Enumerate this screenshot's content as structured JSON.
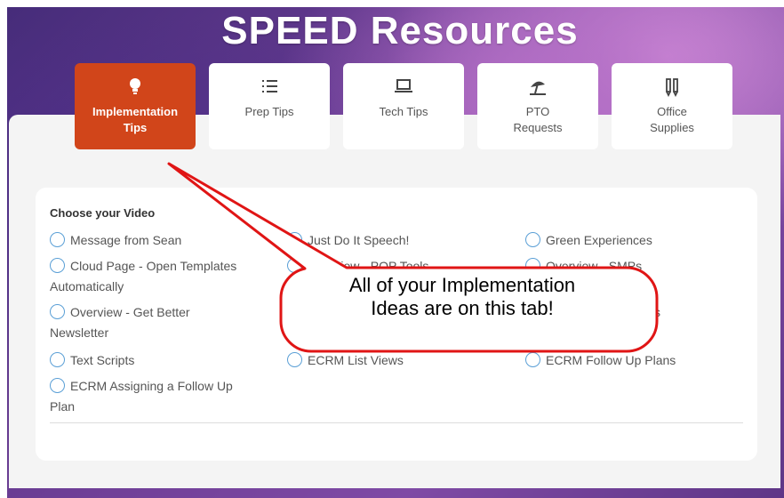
{
  "title": "SPEED Resources",
  "tabs": [
    {
      "label1": "Implementation",
      "label2": "Tips",
      "icon": "lightbulb-icon",
      "active": true
    },
    {
      "label1": "Prep Tips",
      "label2": "",
      "icon": "list-icon",
      "active": false
    },
    {
      "label1": "Tech Tips",
      "label2": "",
      "icon": "laptop-icon",
      "active": false
    },
    {
      "label1": "PTO",
      "label2": "Requests",
      "icon": "beach-umbrella-icon",
      "active": false
    },
    {
      "label1": "Office",
      "label2": "Supplies",
      "icon": "pencils-icon",
      "active": false
    }
  ],
  "video_group": {
    "legend": "Choose your Video",
    "options": {
      "message_from_sean": "Message from Sean",
      "cloud_page_1": "Cloud Page - Open Templates",
      "cloud_page_2": "Automatically",
      "overview_newsletter_1": "Overview - Get Better",
      "overview_newsletter_2": "Newsletter",
      "text_scripts": "Text Scripts",
      "ecrm_assigning_1": "ECRM Assigning a Follow Up",
      "ecrm_assigning_2": "Plan",
      "just_do_it": "Just Do It Speech!",
      "ecrm_list_views": "ECRM List Views",
      "green_experiences": "Green Experiences",
      "ecrm_follow_up_plans": "ECRM Follow Up Plans",
      "partial_col2_row2": "Overview - POP Tools",
      "partial_col3_row2": "Overview - SMPs",
      "partial_col3_row3": "s"
    }
  },
  "callout": {
    "line1": "All of your Implementation",
    "line2": "Ideas are on this tab!"
  },
  "colors": {
    "active_tab": "#d1451a",
    "radio": "#5a9fd6",
    "callout_border": "#e01515"
  }
}
